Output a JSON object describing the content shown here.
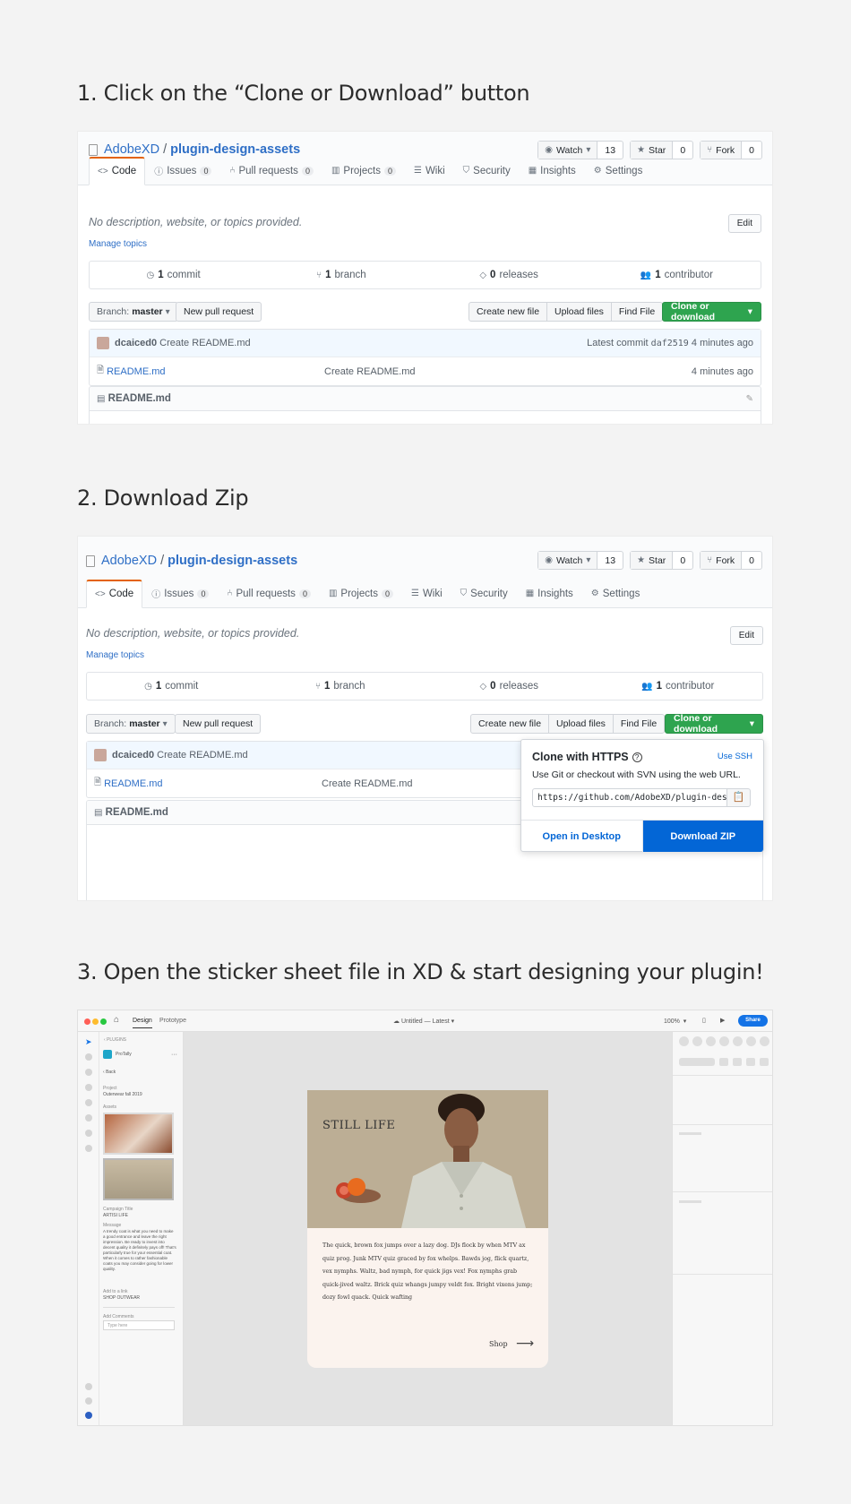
{
  "steps": [
    {
      "title": "1. Click on the “Clone or Download” button"
    },
    {
      "title": "2. Download Zip"
    },
    {
      "title": "3. Open the sticker sheet file in XD & start designing your plugin!"
    }
  ],
  "repo": {
    "owner": "AdobeXD",
    "separator": "/",
    "name": "plugin-design-assets",
    "watch_label": "Watch",
    "watch_count": "13",
    "star_label": "Star",
    "star_count": "0",
    "fork_label": "Fork",
    "fork_count": "0",
    "tabs": [
      {
        "label": "Code",
        "count": ""
      },
      {
        "label": "Issues",
        "count": "0"
      },
      {
        "label": "Pull requests",
        "count": "0"
      },
      {
        "label": "Projects",
        "count": "0"
      },
      {
        "label": "Wiki",
        "count": ""
      },
      {
        "label": "Security",
        "count": ""
      },
      {
        "label": "Insights",
        "count": ""
      },
      {
        "label": "Settings",
        "count": ""
      }
    ],
    "description": "No description, website, or topics provided.",
    "manage_topics": "Manage topics",
    "edit": "Edit",
    "summary": {
      "commits_num": "1",
      "commits_label": "commit",
      "branches_num": "1",
      "branches_label": "branch",
      "releases_num": "0",
      "releases_label": "releases",
      "contributors_num": "1",
      "contributors_label": "contributor"
    },
    "branch_label": "Branch:",
    "branch_value": "master",
    "new_pr": "New pull request",
    "create_file": "Create new file",
    "upload_files": "Upload files",
    "find_file": "Find File",
    "clone_download": "Clone or download",
    "commit_author": "dcaiced0",
    "commit_message": "Create README.md",
    "latest_commit_label": "Latest commit",
    "commit_hash": "daf2519",
    "commit_time": "4 minutes ago",
    "file_name": "README.md",
    "file_message": "Create README.md",
    "file_time": "4 minutes ago",
    "readme_title": "README.md"
  },
  "clone_popup": {
    "title": "Clone with HTTPS",
    "use_ssh": "Use SSH",
    "subtitle": "Use Git or checkout with SVN using the web URL.",
    "url": "https://github.com/AdobeXD/plugin-design-assets.git",
    "open_desktop": "Open in Desktop",
    "download_zip": "Download ZIP"
  },
  "xd": {
    "tab_design": "Design",
    "tab_prototype": "Prototype",
    "doc_title": "Untitled — Latest",
    "zoom": "100%",
    "share": "Share",
    "breadcrumb": "PLUGINS",
    "plugin_name": "ProTally",
    "back": "Back",
    "project_label": "Project",
    "project_value": "Outerwear fall 2019",
    "assets_label": "Assets",
    "campaign_label": "Campaign Title",
    "campaign_value": "ARTISI LIFE",
    "message_label": "Message",
    "message_value": "A trendy coat is what you need to make a good entrance and leave the right impression. Be ready to invest into decent quality it definitely pays off! That's particularly true for your essential coat. When it comes to rather fashionable coats you may consider going for lower quality.",
    "add_link_label": "Add to a link",
    "add_link_value": "SHOP OUTWEAR",
    "add_comments_label": "Add Comments",
    "type_here": "Type here",
    "card_title": "STILL LIFE",
    "card_body": "The quick, brown fox jumps over a lazy dog. DJs flock by when MTV ax quiz prog. Junk MTV quiz graced by fox whelps. Bawds jog, flick quartz, vex nymphs. Waltz, bad nymph, for quick jigs vex! Fox nymphs grab quick-jived waltz. Brick quiz whangs jumpy veldt fox. Bright vixens jump; dozy fowl quack. Quick wafting",
    "card_cta": "Shop"
  },
  "colors": {
    "link": "#2f6fc6",
    "green_button": "#2ea44f",
    "download_blue": "#0366d6",
    "xd_share_blue": "#1473e6",
    "card_bg": "#fbf3ee",
    "photo_bg": "#b9ab92"
  },
  "icons": [
    "book-icon",
    "eye-icon",
    "star-icon",
    "fork-icon",
    "code-icon",
    "issue-icon",
    "pr-icon",
    "project-icon",
    "wiki-icon",
    "shield-icon",
    "graph-icon",
    "gear-icon",
    "commit-icon",
    "branch-icon",
    "tag-icon",
    "people-icon",
    "file-icon",
    "pencil-icon",
    "question-icon",
    "clipboard-icon",
    "home-icon",
    "arrow-icon"
  ]
}
